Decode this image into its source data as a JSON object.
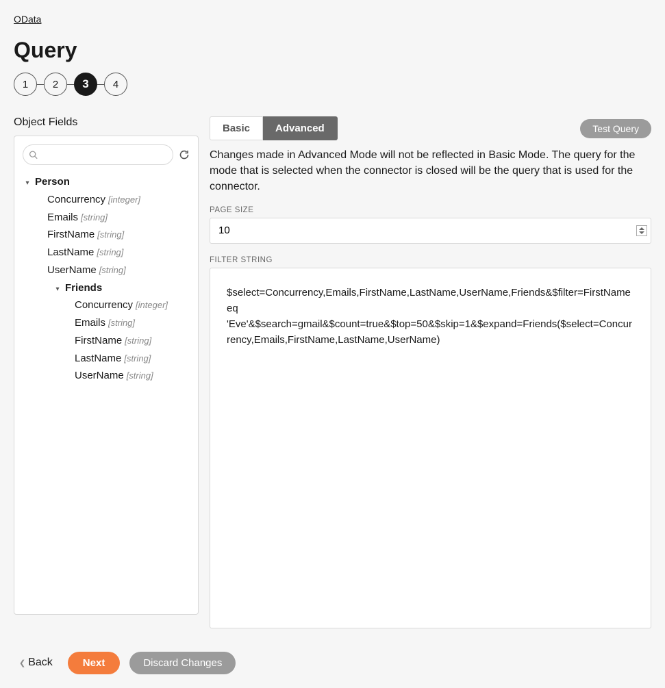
{
  "breadcrumb": "OData",
  "page_title": "Query",
  "stepper": {
    "steps": [
      "1",
      "2",
      "3",
      "4"
    ],
    "active_index": 2
  },
  "left_panel": {
    "title": "Object Fields",
    "search_placeholder": "",
    "tree": {
      "root_label": "Person",
      "root_fields": [
        {
          "name": "Concurrency",
          "type": "[integer]"
        },
        {
          "name": "Emails",
          "type": "[string]"
        },
        {
          "name": "FirstName",
          "type": "[string]"
        },
        {
          "name": "LastName",
          "type": "[string]"
        },
        {
          "name": "UserName",
          "type": "[string]"
        }
      ],
      "child_label": "Friends",
      "child_fields": [
        {
          "name": "Concurrency",
          "type": "[integer]"
        },
        {
          "name": "Emails",
          "type": "[string]"
        },
        {
          "name": "FirstName",
          "type": "[string]"
        },
        {
          "name": "LastName",
          "type": "[string]"
        },
        {
          "name": "UserName",
          "type": "[string]"
        }
      ]
    }
  },
  "right_panel": {
    "tabs": {
      "basic": "Basic",
      "advanced": "Advanced"
    },
    "test_query": "Test Query",
    "notice": "Changes made in Advanced Mode will not be reflected in Basic Mode. The query for the mode that is selected when the connector is closed will be the query that is used for the connector.",
    "page_size_label": "PAGE SIZE",
    "page_size_value": "10",
    "filter_label": "FILTER STRING",
    "filter_value": "$select=Concurrency,Emails,FirstName,LastName,UserName,Friends&$filter=FirstName eq 'Eve'&$search=gmail&$count=true&$top=50&$skip=1&$expand=Friends($select=Concurrency,Emails,FirstName,LastName,UserName)"
  },
  "footer": {
    "back": "Back",
    "next": "Next",
    "discard": "Discard Changes"
  }
}
